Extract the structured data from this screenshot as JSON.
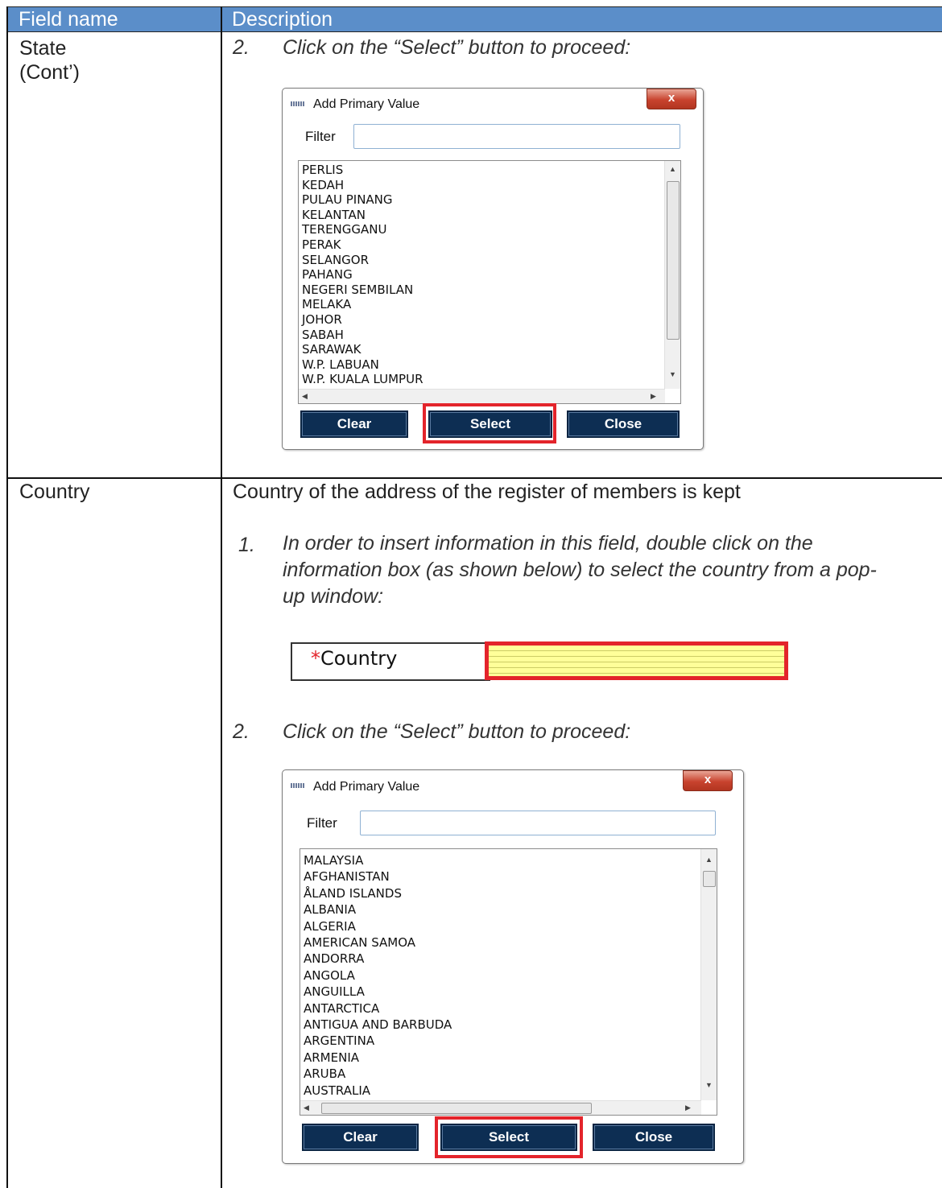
{
  "header": {
    "col1": "Field name",
    "col2": "Description"
  },
  "rows": {
    "state": {
      "field_name": "State",
      "field_name_2": "(Cont’)",
      "step2_num": "2.",
      "step2_text": "Click on the “Select” button to proceed:"
    },
    "country": {
      "field_name": "Country",
      "description": "Country of the address of the register of members is kept",
      "step1_num": "1.",
      "step1_line1": "In order to insert information in this field, double click on the",
      "step1_line2": "information box (as shown below) to select the country from a pop-",
      "step1_line3": "up window:",
      "field_star": "*",
      "field_label": "Country",
      "step2_num": "2.",
      "step2_text": "Click on the “Select” button to proceed:"
    }
  },
  "dialog_state": {
    "title": "Add Primary Value",
    "close_glyph": "x",
    "filter_label": "Filter",
    "filter_value": "",
    "items": [
      "PERLIS",
      "KEDAH",
      "PULAU PINANG",
      "KELANTAN",
      "TERENGGANU",
      "PERAK",
      "SELANGOR",
      "PAHANG",
      "NEGERI SEMBILAN",
      "MELAKA",
      "JOHOR",
      "SABAH",
      "SARAWAK",
      "W.P. LABUAN",
      "W.P. KUALA LUMPUR"
    ],
    "buttons": {
      "clear": "Clear",
      "select": "Select",
      "close": "Close"
    }
  },
  "dialog_country": {
    "title": "Add Primary Value",
    "close_glyph": "x",
    "filter_label": "Filter",
    "filter_value": "",
    "items": [
      "MALAYSIA",
      "AFGHANISTAN",
      "ÅLAND ISLANDS",
      "ALBANIA",
      "ALGERIA",
      "AMERICAN SAMOA",
      "ANDORRA",
      "ANGOLA",
      "ANGUILLA",
      "ANTARCTICA",
      "ANTIGUA AND BARBUDA",
      "ARGENTINA",
      "ARMENIA",
      "ARUBA",
      "AUSTRALIA"
    ],
    "buttons": {
      "clear": "Clear",
      "select": "Select",
      "close": "Close"
    }
  },
  "colors": {
    "header_bg": "#5b8ec9",
    "button_bg": "#0d2e53",
    "highlight": "#e3242b",
    "field_fill": "#ffff99"
  }
}
